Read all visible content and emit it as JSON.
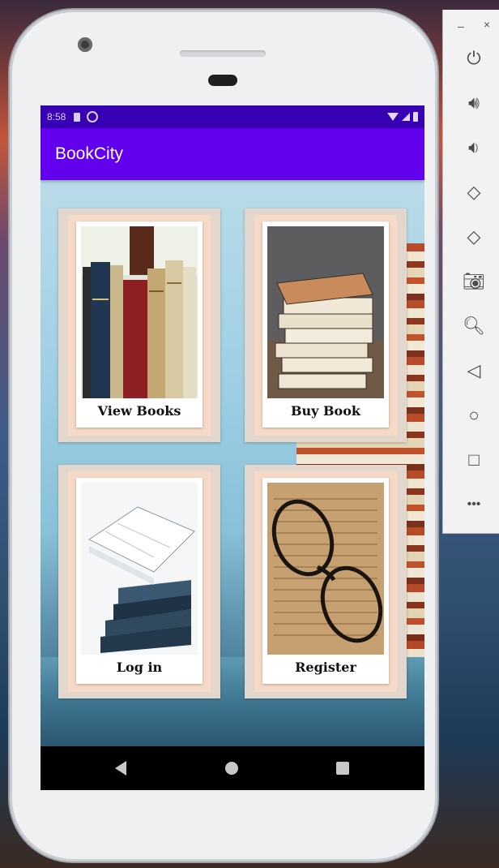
{
  "app": {
    "title": "BookCity"
  },
  "status_bar": {
    "time": "8:58"
  },
  "cards": [
    {
      "label": "View Books"
    },
    {
      "label": "Buy Book"
    },
    {
      "label": "Log in"
    },
    {
      "label": "Register"
    }
  ],
  "emulator_toolbar": {
    "minimize": "–",
    "close": "×",
    "buttons": [
      {
        "icon": "power-icon",
        "glyph": "⏻"
      },
      {
        "icon": "volume-up-icon",
        "glyph": "🔊︎"
      },
      {
        "icon": "volume-down-icon",
        "glyph": "🔉︎"
      },
      {
        "icon": "rotate-left-icon",
        "glyph": "◇"
      },
      {
        "icon": "rotate-right-icon",
        "glyph": "◇"
      },
      {
        "icon": "camera-icon",
        "glyph": "📷︎"
      },
      {
        "icon": "zoom-icon",
        "glyph": "🔍︎"
      },
      {
        "icon": "back-icon",
        "glyph": "◁"
      },
      {
        "icon": "home-icon",
        "glyph": "○"
      },
      {
        "icon": "overview-icon",
        "glyph": "□"
      },
      {
        "icon": "more-icon",
        "glyph": "•••"
      }
    ]
  },
  "colors": {
    "status_bar": "#3700b3",
    "app_bar": "#6200ee",
    "nav_bar": "#000000"
  }
}
